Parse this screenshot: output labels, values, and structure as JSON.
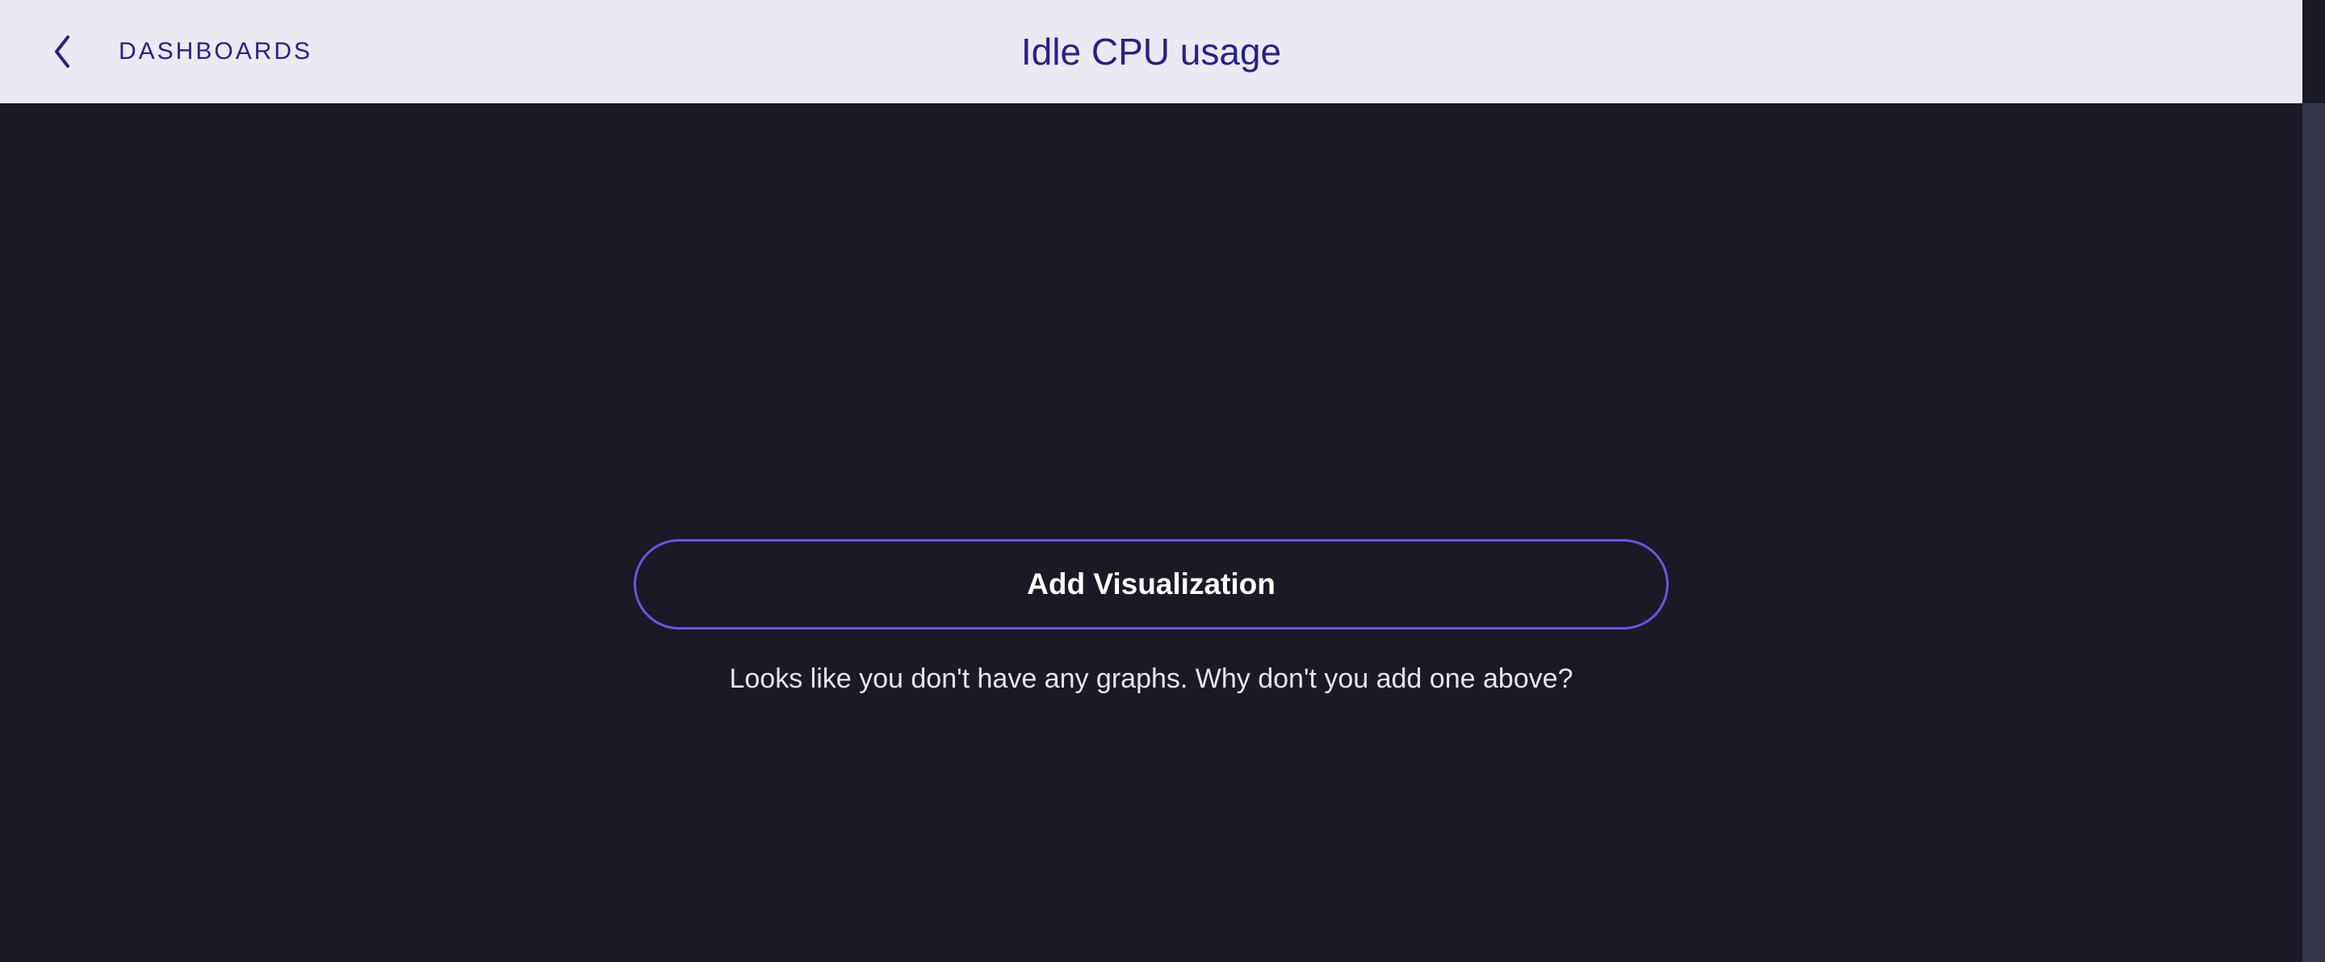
{
  "header": {
    "back_label": "DASHBOARDS",
    "title": "Idle CPU usage"
  },
  "main": {
    "add_button_label": "Add Visualization",
    "empty_hint": "Looks like you don't have any graphs. Why don't you add one above?"
  },
  "colors": {
    "accent": "#6a54e8",
    "header_bg": "#ebeaf2",
    "header_text": "#2a1e8f",
    "body_bg": "#1a1a24"
  }
}
